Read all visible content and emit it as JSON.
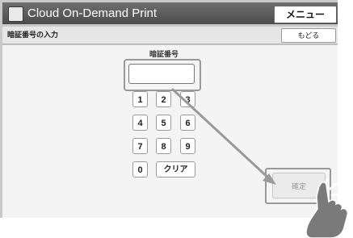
{
  "app": {
    "title": "Cloud On-Demand Print",
    "menu_label": "メニュー"
  },
  "header": {
    "screen_label": "暗証番号の入力",
    "back_label": "もどる"
  },
  "form": {
    "field_label": "暗証番号",
    "pin_value": ""
  },
  "keypad": {
    "keys": [
      "1",
      "2",
      "3",
      "4",
      "5",
      "6",
      "7",
      "8",
      "9",
      "0",
      "クリア"
    ]
  },
  "actions": {
    "confirm_label": "確定"
  },
  "icons": {
    "app": "printer-app-icon",
    "pointer": "pointing-hand-icon",
    "tap": "tap-indicator-icon",
    "arrow": "guide-arrow"
  },
  "colors": {
    "title_bar": "#555555",
    "overlay": "#c9c9c9",
    "guide": "#9a9a9a"
  }
}
